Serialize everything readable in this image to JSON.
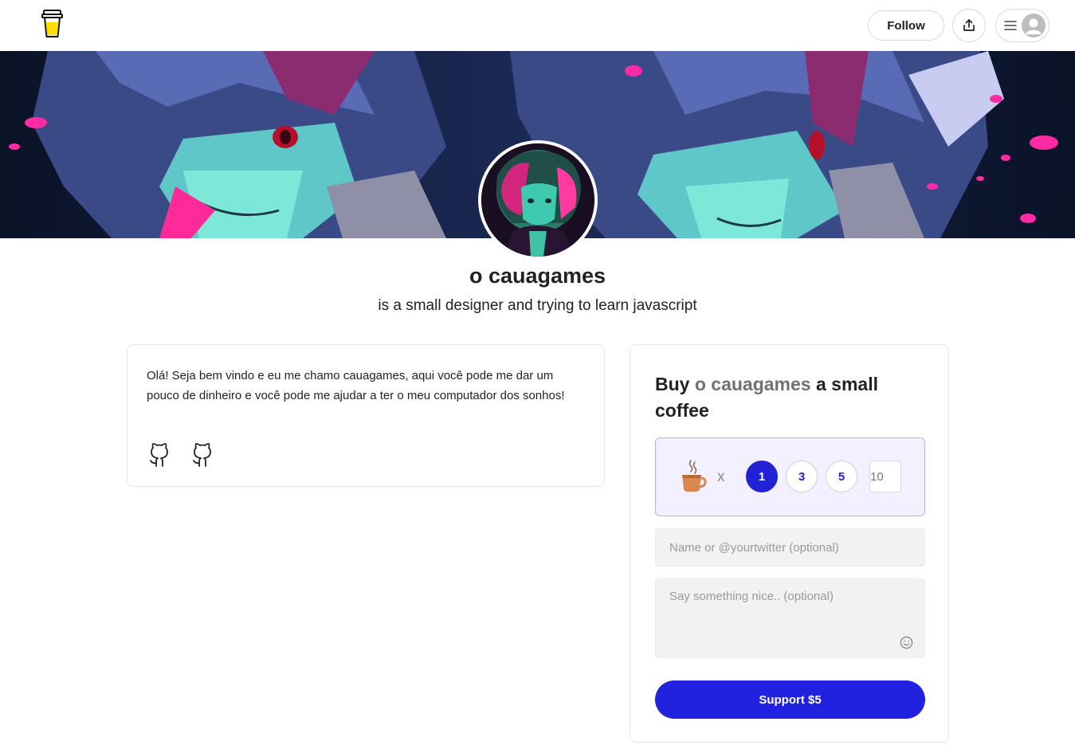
{
  "header": {
    "follow_label": "Follow"
  },
  "profile": {
    "name": "o cauagames",
    "tagline": "is a small designer and trying to learn javascript"
  },
  "about": {
    "text": "Olá! Seja bem vindo e eu me chamo cauagames, aqui você pode me dar um pouco de dinheiro e você pode me ajudar a ter o meu computador dos sonhos!",
    "social_icons": [
      "github-icon",
      "github-icon"
    ]
  },
  "support": {
    "title_prefix": "Buy ",
    "title_name": "o cauagames",
    "title_suffix": " a small coffee",
    "times": "x",
    "quantities": [
      "1",
      "3",
      "5"
    ],
    "selected_quantity": "1",
    "custom_placeholder": "10",
    "name_placeholder": "Name or @yourtwitter (optional)",
    "message_placeholder": "Say something nice.. (optional)",
    "button_label": "Support $5"
  },
  "colors": {
    "accent": "#2121e0",
    "qty_box_bg": "#f3f1ff",
    "qty_box_border": "#b7b1ee"
  }
}
